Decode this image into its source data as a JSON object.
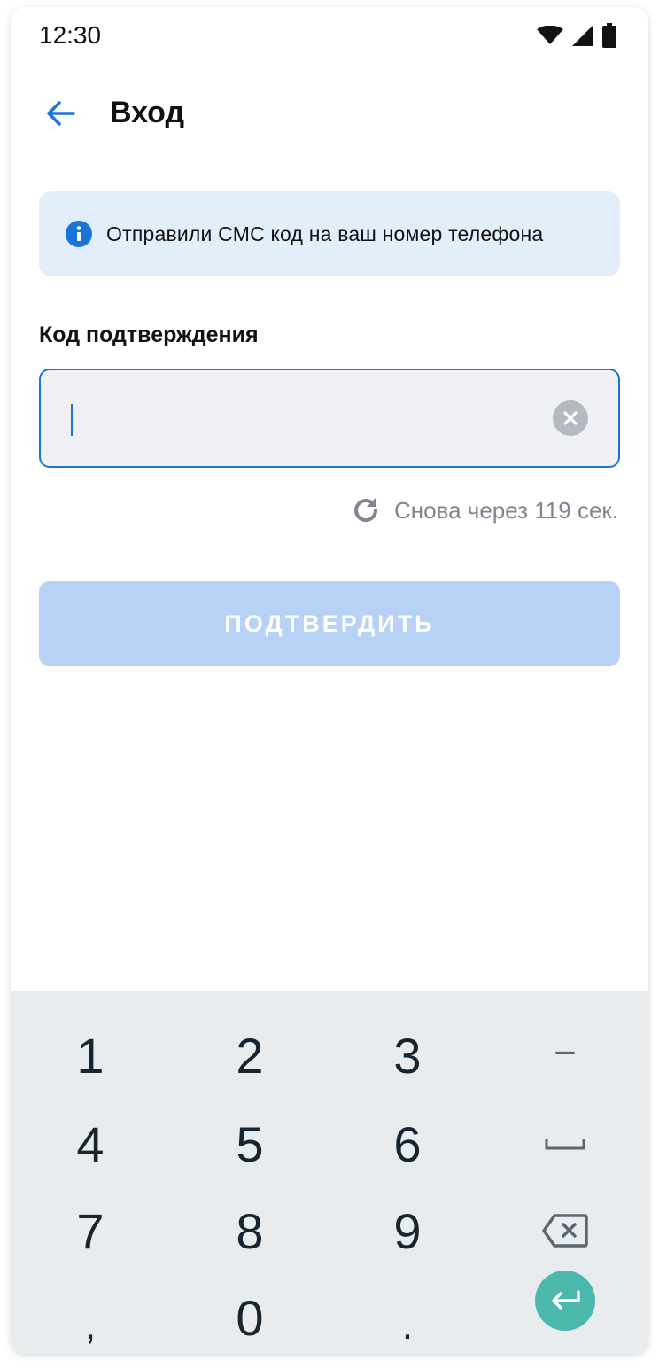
{
  "status_bar": {
    "time": "12:30"
  },
  "header": {
    "title": "Вход"
  },
  "info": {
    "text": "Отправили СМС код на ваш номер телефона"
  },
  "field": {
    "label": "Код подтверждения",
    "value": "",
    "placeholder": ""
  },
  "resend": {
    "text": "Снова через 119 сек."
  },
  "confirm": {
    "label": "ПОДТВЕРДИТЬ"
  },
  "keyboard": {
    "row1": [
      "1",
      "2",
      "3",
      "−"
    ],
    "row2": [
      "4",
      "5",
      "6"
    ],
    "row3": [
      "7",
      "8",
      "9"
    ],
    "row4": [
      ",",
      "0",
      "."
    ]
  },
  "colors": {
    "accent": "#1a73d9",
    "banner_bg": "#e3eefb",
    "button_disabled": "#b7d2f4",
    "enter_key": "#4bb8ad",
    "keyboard_bg": "#e9ecee"
  }
}
